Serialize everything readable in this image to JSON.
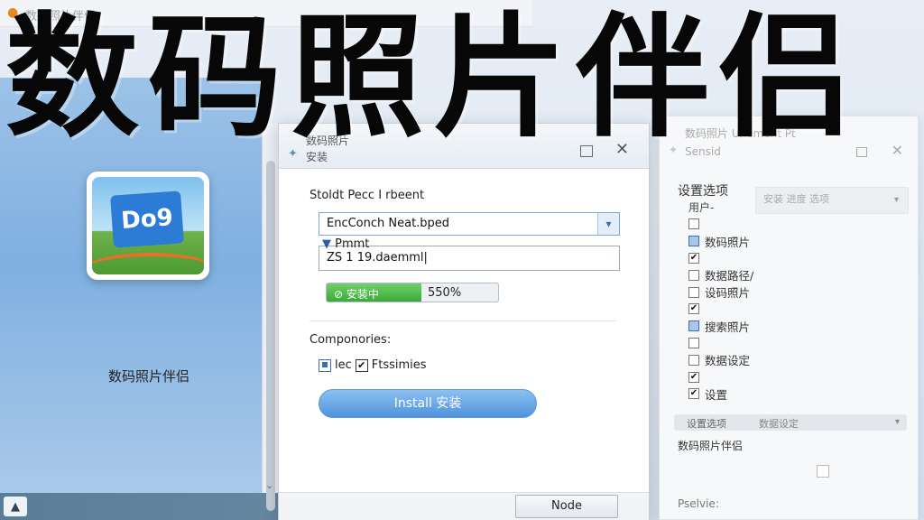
{
  "overlay_title": "数码照片伴侣",
  "topbar": {
    "label": "数码照片伴侣"
  },
  "desktop": {
    "icon_art_text": "Do9",
    "icon_label": "数码照片伴侣"
  },
  "installer": {
    "title_line1": "数码照片",
    "title_line2": "安装",
    "destination_label": "Stoldt Pecc I rbeent",
    "destination_value": "EncConch Neat.bped",
    "path_label": "Pmmt",
    "path_value": "ZS 1 19.daemml",
    "progress_status": "安装中",
    "progress_percent_text": "550%",
    "progress_fraction": 0.55,
    "components_label": "Componories:",
    "component_1": "lec",
    "component_2": "Ftssimies",
    "install_button": "Install 安装",
    "next_button": "Node"
  },
  "settings": {
    "title_line1": "数码照片 Unement Pt",
    "title_line2": "Sensid",
    "heading": "设置选项",
    "subheading": "用户-",
    "dropdown_text": "安装 进度 选项",
    "items": [
      {
        "label": "",
        "state": "unchecked"
      },
      {
        "label": "数码照片",
        "state": "blue"
      },
      {
        "label": "",
        "state": "checked"
      },
      {
        "label": "数据路径/",
        "state": "unchecked"
      },
      {
        "label": "设码照片",
        "state": "unchecked"
      },
      {
        "label": "",
        "state": "checked"
      },
      {
        "label": "搜索照片",
        "state": "blue"
      },
      {
        "label": "",
        "state": "unchecked"
      },
      {
        "label": "数据设定",
        "state": "unchecked"
      },
      {
        "label": "",
        "state": "checked"
      },
      {
        "label": "设置",
        "state": "checked"
      }
    ],
    "bar_text_1": "设置选项",
    "bar_text_2": "数据设定",
    "app_name": "数码照片伴侣",
    "footer": "Pselvie:"
  },
  "colors": {
    "accent": "#4f92dc",
    "progress": "#3aa936"
  }
}
